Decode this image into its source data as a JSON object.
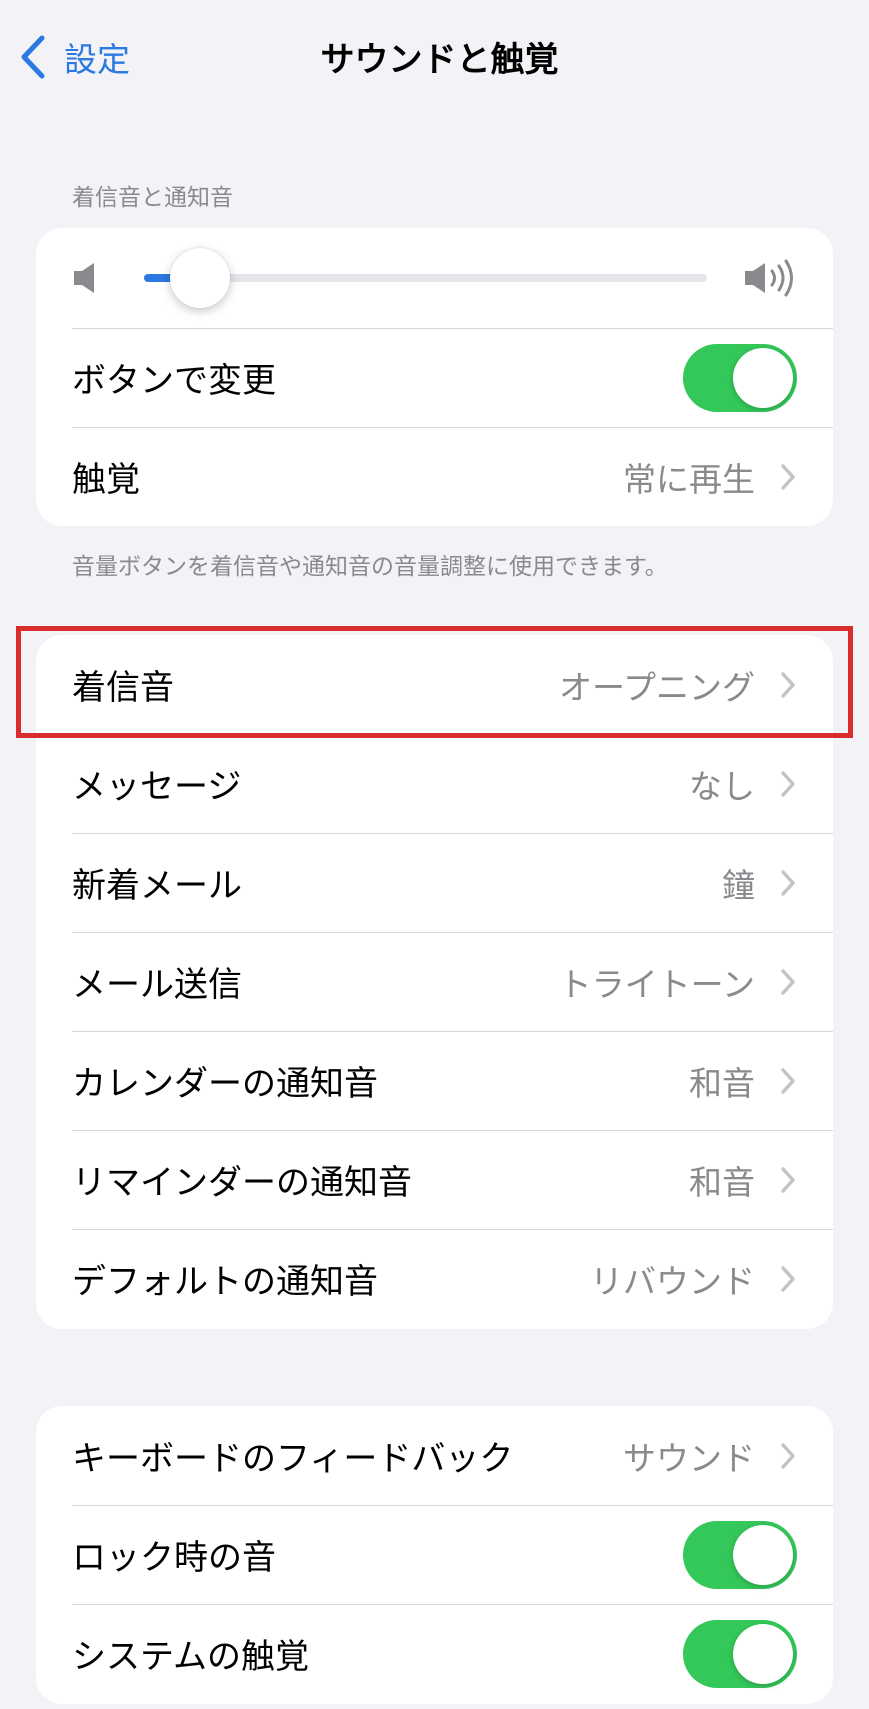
{
  "nav": {
    "back_label": "設定",
    "title": "サウンドと触覚"
  },
  "ringer_section": {
    "header": "着信音と通知音",
    "volume_level": 0.1,
    "change_with_buttons_label": "ボタンで変更",
    "change_with_buttons_on": true,
    "haptics_label": "触覚",
    "haptics_value": "常に再生",
    "footer": "音量ボタンを着信音や通知音の音量調整に使用できます。"
  },
  "sounds": [
    {
      "label": "着信音",
      "value": "オープニング"
    },
    {
      "label": "メッセージ",
      "value": "なし"
    },
    {
      "label": "新着メール",
      "value": "鐘"
    },
    {
      "label": "メール送信",
      "value": "トライトーン"
    },
    {
      "label": "カレンダーの通知音",
      "value": "和音"
    },
    {
      "label": "リマインダーの通知音",
      "value": "和音"
    },
    {
      "label": "デフォルトの通知音",
      "value": "リバウンド"
    }
  ],
  "system": {
    "keyboard_feedback_label": "キーボードのフィードバック",
    "keyboard_feedback_value": "サウンド",
    "lock_sound_label": "ロック時の音",
    "lock_sound_on": true,
    "system_haptics_label": "システムの触覚",
    "system_haptics_on": true
  },
  "colors": {
    "accent": "#2a7ae2",
    "toggle_on": "#34c759",
    "highlight": "#d92d2d",
    "background": "#f2f2f7"
  }
}
